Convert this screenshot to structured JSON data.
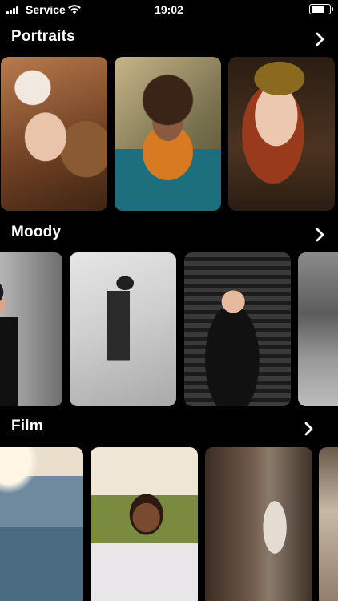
{
  "status_bar": {
    "carrier": "Service",
    "time": "19:02",
    "battery_level": 0.8
  },
  "sections": [
    {
      "title": "Portraits",
      "chevron_icon": "chevron-right-icon"
    },
    {
      "title": "Moody",
      "chevron_icon": "chevron-right-icon"
    },
    {
      "title": "Film",
      "chevron_icon": "chevron-right-icon"
    }
  ],
  "colors": {
    "background": "#000000",
    "text": "#ffffff"
  }
}
